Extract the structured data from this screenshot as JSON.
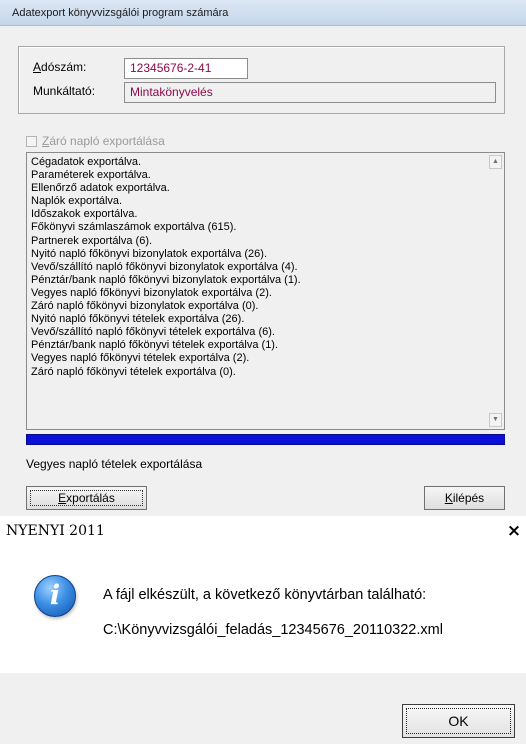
{
  "export_window": {
    "title": "Adatexport könyvvizsgálói program számára",
    "tax_number_label_first": "A",
    "tax_number_label_rest": "dószám:",
    "tax_number_value": "12345676-2-41",
    "employer_label": "Munkáltató:",
    "employer_value": "Mintakönyvelés",
    "closing_journal_checkbox_label_first": "Z",
    "closing_journal_checkbox_label_rest": "áró napló exportálása",
    "log_lines": [
      "Cégadatok exportálva.",
      "Paraméterek exportálva.",
      "Ellenőrző adatok exportálva.",
      "Naplók exportálva.",
      "Időszakok exportálva.",
      "Főkönyvi számlaszámok exportálva (615).",
      "Partnerek exportálva (6).",
      "Nyitó napló főkönyvi bizonylatok exportálva (26).",
      "Vevő/szállító napló főkönyvi bizonylatok exportálva (4).",
      "Pénztár/bank napló főkönyvi bizonylatok exportálva (1).",
      "Vegyes napló főkönyvi bizonylatok exportálva (2).",
      "Záró napló főkönyvi bizonylatok exportálva (0).",
      "Nyitó napló főkönyvi tételek exportálva (26).",
      "Vevő/szállító napló főkönyvi tételek exportálva (6).",
      "Pénztár/bank napló főkönyvi tételek exportálva (1).",
      "Vegyes napló főkönyvi tételek exportálva (2).",
      "Záró napló főkönyvi tételek exportálva (0)."
    ],
    "progress_fraction": 1.0,
    "status_text": "Vegyes napló tételek exportálása",
    "export_button_first": "E",
    "export_button_rest": "xportálás",
    "exit_button_first": "K",
    "exit_button_rest": "ilépés"
  },
  "message_box": {
    "title": "NYENYI 2011",
    "close_glyph": "×",
    "icon": "info-icon",
    "message_line1": "A fájl elkészült, a következő könyvtárban található:",
    "message_line2": "C:\\Könyvvizsgálói_feladás_12345676_20110322.xml",
    "ok_label": "OK"
  },
  "colors": {
    "progress_fill": "#0a10d8",
    "field_text": "#8b0b4b"
  }
}
